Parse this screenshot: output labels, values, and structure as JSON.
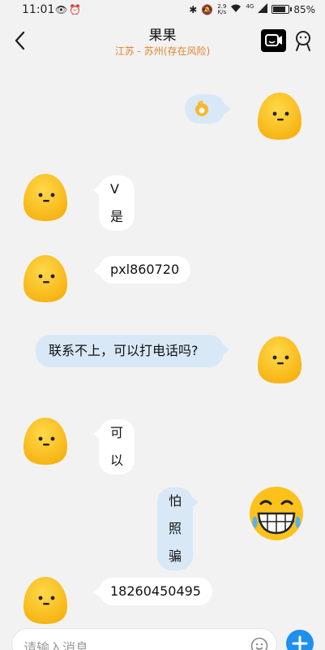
{
  "status_bar": {
    "time": "11:01",
    "net_speed_value": "2.9",
    "net_speed_unit": "K/s",
    "signal_label": "4G",
    "battery": "85%"
  },
  "header": {
    "contact_name": "果果",
    "contact_location": "江苏 - 苏州(存在风险)"
  },
  "messages": [
    {
      "direction": "out",
      "text": "",
      "kind": "emoji-sticker"
    },
    {
      "direction": "in",
      "text": "V是"
    },
    {
      "direction": "in",
      "text": "pxl860720"
    },
    {
      "direction": "out",
      "text": "联系不上，可以打电话吗?"
    },
    {
      "direction": "in",
      "text": "可以"
    },
    {
      "direction": "out",
      "text": "怕照骗"
    },
    {
      "direction": "in",
      "text": "18260450495"
    }
  ],
  "input": {
    "placeholder": "请输入消息"
  },
  "colors": {
    "incoming_bubble": "#ffffff",
    "outgoing_bubble": "#d8e8f6",
    "location_risk": "#e2832b",
    "accent": "#1f8ff0",
    "avatar_yellow": "#f9c21b"
  }
}
